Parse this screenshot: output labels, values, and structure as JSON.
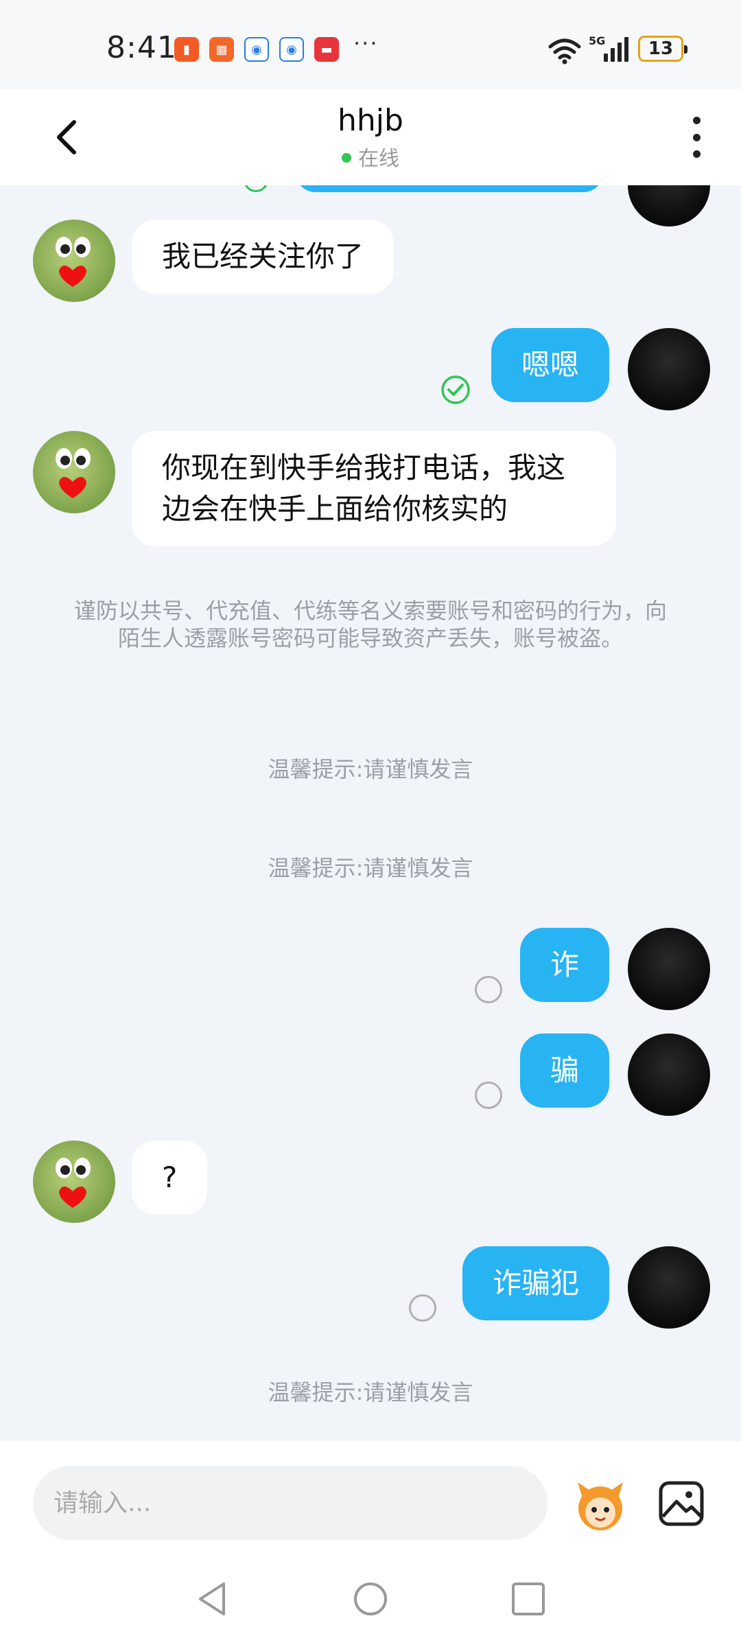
{
  "status_bar": {
    "time": "8:41",
    "network": "5G",
    "battery": "13",
    "more": "···"
  },
  "header": {
    "title": "hhjb",
    "status": "在线",
    "status_color": "#2ec654"
  },
  "messages": [
    {
      "side": "left",
      "text": "我已经关注你了"
    },
    {
      "side": "right",
      "text": "嗯嗯",
      "read": true
    },
    {
      "side": "left",
      "text": "你现在到快手给我打电话，我这边会在快手上面给你核实的"
    },
    {
      "side": "right",
      "text": "诈",
      "read": false
    },
    {
      "side": "right",
      "text": "骗",
      "read": false
    },
    {
      "side": "left",
      "text": "?"
    },
    {
      "side": "right",
      "text": "诈骗犯",
      "read": false
    }
  ],
  "warning": "谨防以共号、代充值、代练等名义索要账号和密码的行为，向陌生人透露账号密码可能导致资产丢失，账号被盗。",
  "tips": [
    "温馨提示:请谨慎发言",
    "温馨提示:请谨慎发言",
    "温馨提示:请谨慎发言"
  ],
  "input": {
    "placeholder": "请输入..."
  },
  "colors": {
    "accent": "#28b3f3",
    "background": "#f1f4f9",
    "read_check": "#2ec654"
  }
}
